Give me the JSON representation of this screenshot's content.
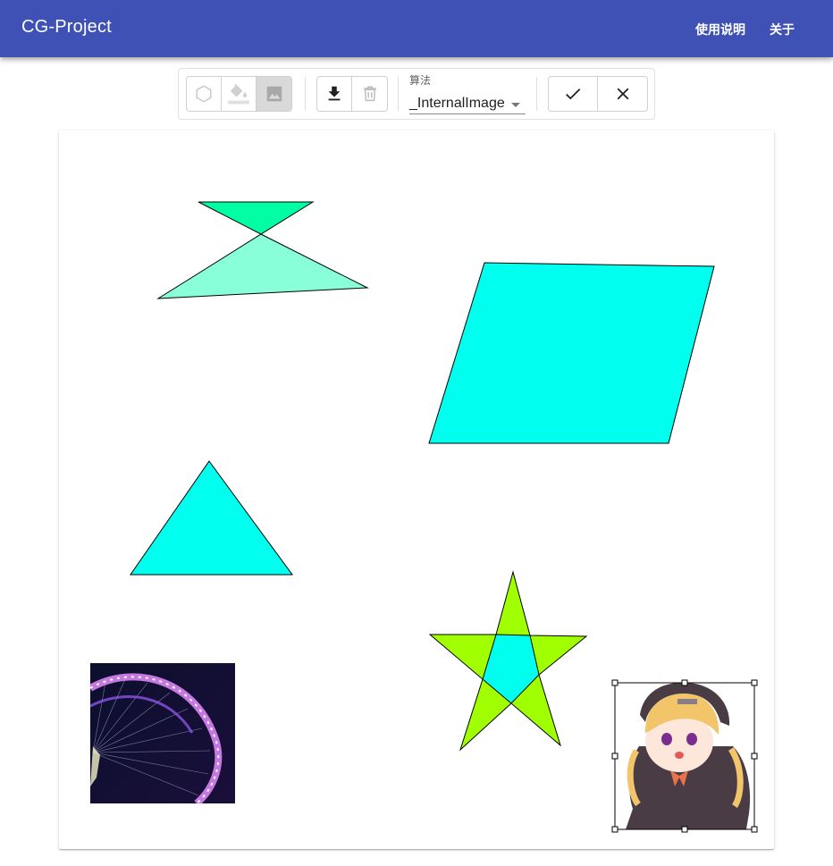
{
  "app": {
    "title": "CG-Project"
  },
  "nav": {
    "help": "使用说明",
    "about": "关于"
  },
  "toolbar": {
    "tools": [
      {
        "icon": "hexagon-icon",
        "enabled": false
      },
      {
        "icon": "fill-bucket-icon",
        "enabled": false
      },
      {
        "icon": "image-icon",
        "active": true
      }
    ],
    "actions": [
      {
        "icon": "download-icon"
      },
      {
        "icon": "trash-icon",
        "enabled": false
      }
    ],
    "algorithm": {
      "label": "算法",
      "value": "_InternalImage"
    },
    "confirm": [
      {
        "icon": "check-icon"
      },
      {
        "icon": "close-icon"
      }
    ]
  },
  "canvas": {
    "shapes": [
      {
        "name": "bowtie-polygon",
        "type": "polygon",
        "fill_top": "#00ffa5",
        "fill_bottom": "#88ffd8"
      },
      {
        "name": "parallelogram",
        "type": "polygon",
        "fill": "#00ffee"
      },
      {
        "name": "triangle",
        "type": "polygon",
        "fill": "#00ffee"
      },
      {
        "name": "star",
        "type": "polygon",
        "fill_points": "#a0ff00",
        "fill_center": "#00ffee"
      },
      {
        "name": "ferris-wheel-image",
        "type": "image"
      },
      {
        "name": "anime-girl-image",
        "type": "image",
        "selected": true
      }
    ]
  },
  "colors": {
    "appbar": "#3f51b5",
    "bowtie_top": "#00ffa5",
    "bowtie_bottom": "#88ffd8",
    "cyan": "#00ffee",
    "lime": "#a0ff00"
  }
}
